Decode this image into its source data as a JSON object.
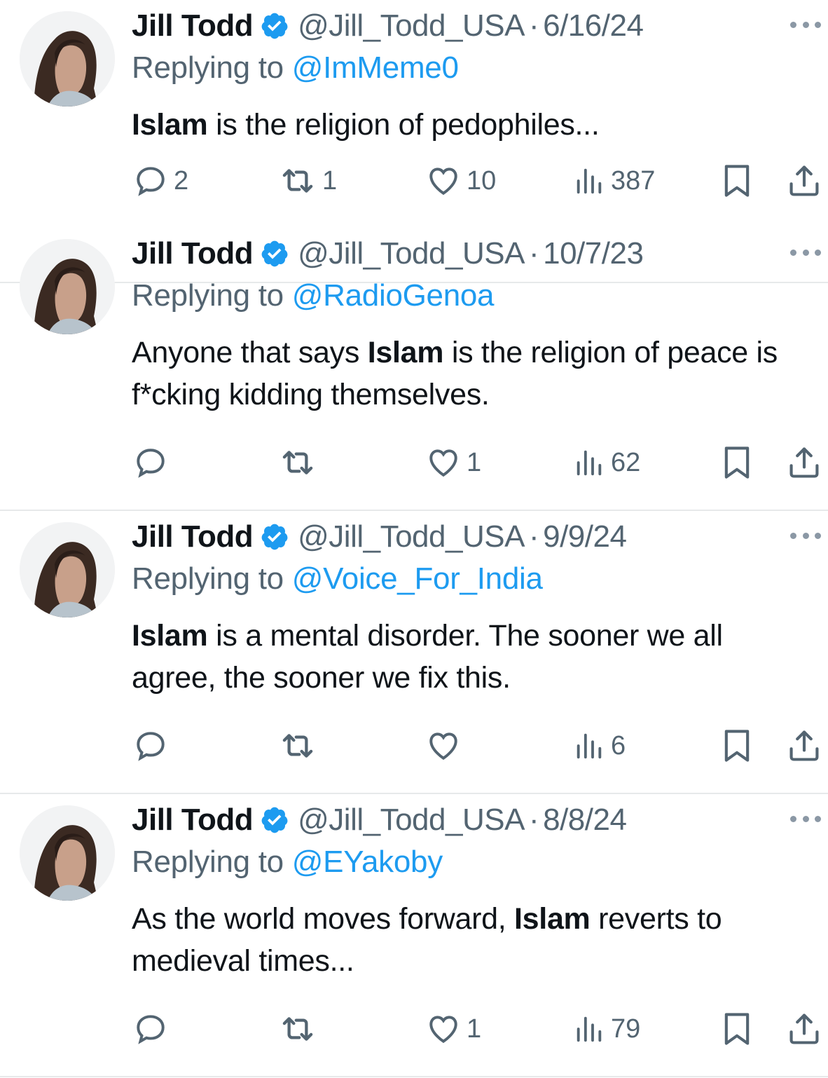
{
  "accent_color": "#1d9bf0",
  "muted_color": "#536471",
  "tweets": [
    {
      "name": "Jill Todd",
      "handle": "@Jill_Todd_USA",
      "separator": "·",
      "date": "6/16/24",
      "reply_label": "Replying to",
      "reply_to": "@ImMeme0",
      "text": {
        "p1": "",
        "b1": "Islam",
        "p2": " is the religion of pedophiles...",
        "b2": "",
        "p3": ""
      },
      "reply_count": "2",
      "retweet_count": "1",
      "like_count": "10",
      "view_count": "387"
    },
    {
      "name": "Jill Todd",
      "handle": "@Jill_Todd_USA",
      "separator": "·",
      "date": "10/7/23",
      "reply_label": "Replying to",
      "reply_to": "@RadioGenoa",
      "text": {
        "p1": "Anyone that says ",
        "b1": "Islam",
        "p2": " is the religion of peace is f*cking kidding themselves.",
        "b2": "",
        "p3": ""
      },
      "reply_count": "",
      "retweet_count": "",
      "like_count": "1",
      "view_count": "62"
    },
    {
      "name": "Jill Todd",
      "handle": "@Jill_Todd_USA",
      "separator": "·",
      "date": "9/9/24",
      "reply_label": "Replying to",
      "reply_to": "@Voice_For_India",
      "text": {
        "p1": "",
        "b1": "Islam",
        "p2": " is a mental disorder.  The sooner we all agree, the sooner we fix this.",
        "b2": "",
        "p3": ""
      },
      "reply_count": "",
      "retweet_count": "",
      "like_count": "",
      "view_count": "6"
    },
    {
      "name": "Jill Todd",
      "handle": "@Jill_Todd_USA",
      "separator": "·",
      "date": "8/8/24",
      "reply_label": "Replying to",
      "reply_to": "@EYakoby",
      "text": {
        "p1": "As the world moves forward, ",
        "b1": "Islam",
        "p2": " reverts to medieval times...",
        "b2": "",
        "p3": ""
      },
      "reply_count": "",
      "retweet_count": "",
      "like_count": "1",
      "view_count": "79"
    }
  ],
  "icons": {
    "verified": "verified-badge-icon",
    "more": "more-icon",
    "reply": "reply-icon",
    "retweet": "retweet-icon",
    "like": "heart-icon",
    "views": "views-icon",
    "bookmark": "bookmark-icon",
    "share": "share-icon"
  }
}
